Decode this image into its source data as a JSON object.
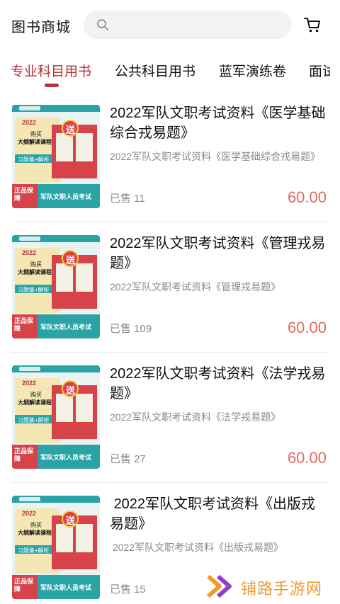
{
  "header": {
    "title": "图书商城",
    "search_placeholder": "",
    "search_icon": "search-icon",
    "cart_icon": "cart-icon"
  },
  "tabs": [
    {
      "label": "专业科目用书",
      "active": true
    },
    {
      "label": "公共科目用书",
      "active": false
    },
    {
      "label": "蓝军演练卷",
      "active": false
    },
    {
      "label": "面试",
      "active": false
    }
  ],
  "products": [
    {
      "title": "2022军队文职考试资料《医学基础综合戎易题》",
      "subtitle": "2022军队文职考试资料《医学基础综合戎易题》",
      "sold_label": "已售",
      "sold_count": "11",
      "price": "60.00"
    },
    {
      "title": "2022军队文职考试资料《管理戎易题》",
      "subtitle": "2022军队文职考试资料《管理戎易题》",
      "sold_label": "已售",
      "sold_count": "109",
      "price": "60.00"
    },
    {
      "title": "2022军队文职考试资料《法学戎易题》",
      "subtitle": "2022军队文职考试资料《法学戎易题》",
      "sold_label": "已售",
      "sold_count": "27",
      "price": "60.00"
    },
    {
      "title": " 2022军队文职考试资料《出版戎易题》",
      "subtitle": " 2022军队文职考试资料《出版戎易题》",
      "sold_label": "已售",
      "sold_count": "15",
      "price": ""
    }
  ],
  "thumbnail": {
    "year": "2022",
    "gift_badge": "送",
    "buy_line1": "购买",
    "buy_line2": "大纲解读课程",
    "tag": "习题集+解析",
    "guarantee": "正品保障",
    "bottom_text": "军队文职人员考试"
  },
  "watermark": {
    "text": "铺路手游网"
  },
  "colors": {
    "accent": "#b8323a",
    "price": "#e26a5f",
    "muted": "#8a8a8a",
    "thumb_teal": "#2aa3a6",
    "thumb_red": "#d8434a",
    "watermark": "#f19a2c"
  }
}
